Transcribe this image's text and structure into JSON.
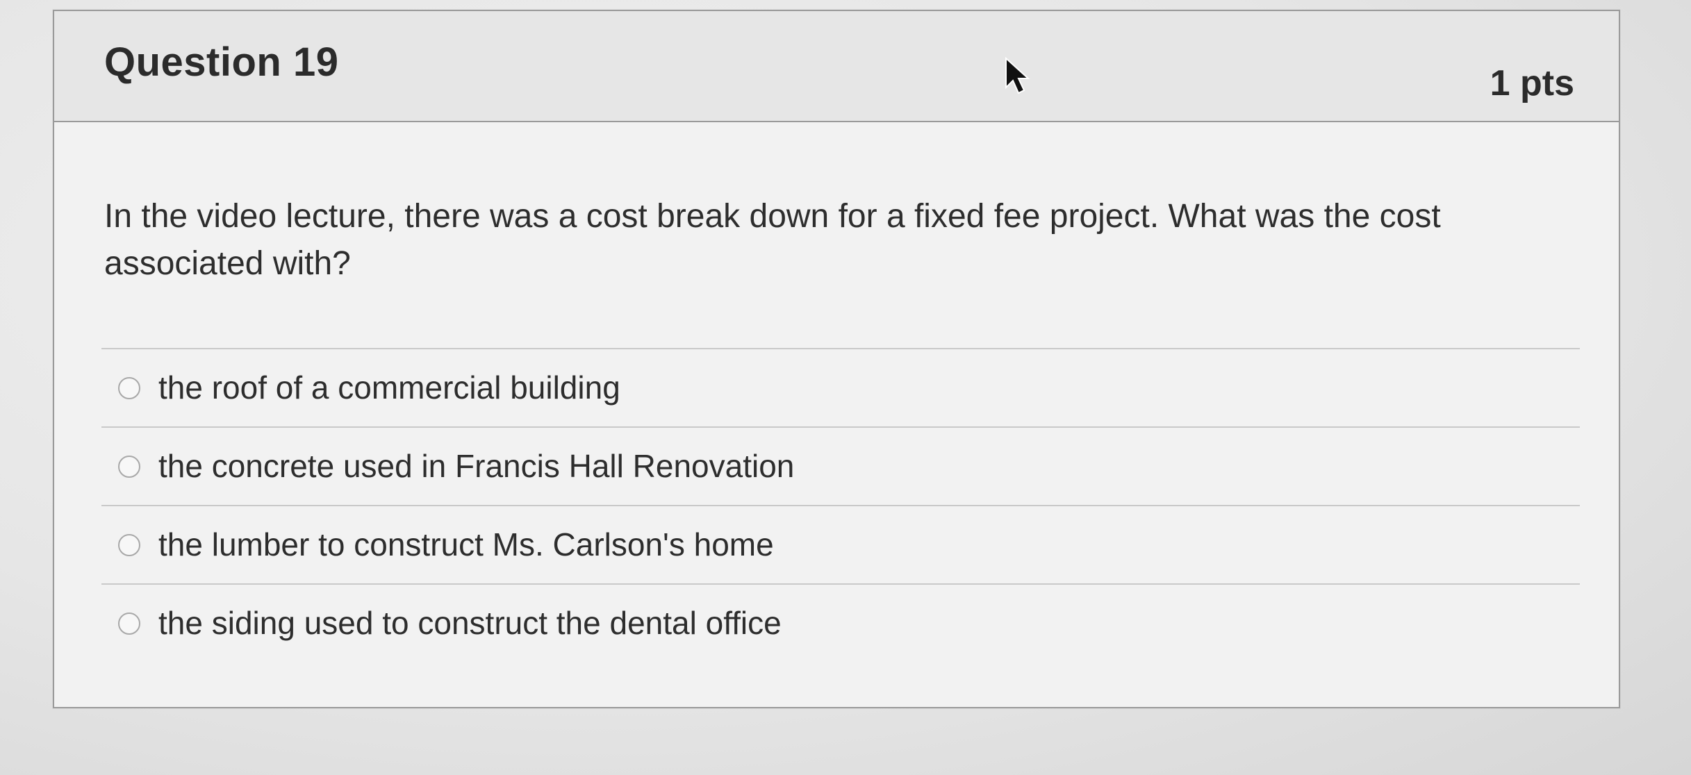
{
  "question": {
    "title": "Question 19",
    "points": "1 pts",
    "text": "In the video lecture, there was a cost break down for a fixed fee project.  What was the cost associated with?"
  },
  "answers": [
    {
      "label": "the roof of a commercial building"
    },
    {
      "label": "the concrete used in Francis Hall Renovation"
    },
    {
      "label": "the lumber to construct Ms. Carlson's home"
    },
    {
      "label": "the siding used to construct the dental office"
    }
  ],
  "colors": {
    "background": "#e9e9e9",
    "card": "#f2f2f2",
    "header": "#e6e6e6",
    "border": "#9a9a9a",
    "text": "#2d2d2d"
  },
  "icons": {
    "cursor": "mouse-pointer-icon",
    "radio": "radio-button-icon"
  }
}
